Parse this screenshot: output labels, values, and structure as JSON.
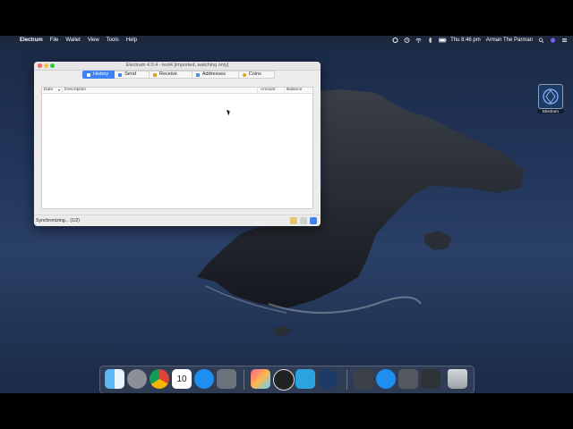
{
  "menubar": {
    "app": "Electrum",
    "items": [
      "File",
      "Wallet",
      "View",
      "Tools",
      "Help"
    ],
    "clock": "Thu 8:46 pm",
    "user": "Arman The Parman",
    "icons": [
      "apple-icon",
      "gear-icon",
      "clock-icon",
      "wifi-icon",
      "bluetooth-icon",
      "battery-icon",
      "search-icon",
      "siri-icon",
      "menu-icon"
    ]
  },
  "window": {
    "title": "Electrum 4.0.4  -  test4  [imported, watching only]",
    "tabs": [
      {
        "label": "History",
        "icon": "history-icon",
        "active": true
      },
      {
        "label": "Send",
        "icon": "send-icon",
        "active": false
      },
      {
        "label": "Receive",
        "icon": "receive-icon",
        "active": false
      },
      {
        "label": "Addresses",
        "icon": "addresses-icon",
        "active": false
      },
      {
        "label": "Coins",
        "icon": "coins-icon",
        "active": false
      }
    ],
    "columns": [
      "Date",
      "Description",
      "Amount",
      "Balance"
    ],
    "status": "Synchronizing... (1/2)",
    "status_icons": [
      "lock-icon",
      "preferences-icon",
      "network-icon"
    ]
  },
  "desktop_icon": {
    "label": "Electrum",
    "icon": "electrum-icon"
  },
  "dock": {
    "apps": [
      "finder-icon",
      "launchpad-icon",
      "chrome-icon",
      "calendar-icon",
      "app-store-icon",
      "system-preferences-icon",
      "final-cut-icon",
      "obs-icon",
      "telegram-icon",
      "electrum-icon",
      "screenshot-icon",
      "app-store-icon",
      "image-capture-icon",
      "photo-icon",
      "trash-icon"
    ],
    "calendar_day": "10"
  },
  "colors": {
    "accent": "#3d82f6",
    "wallpaper": "#22345a"
  }
}
